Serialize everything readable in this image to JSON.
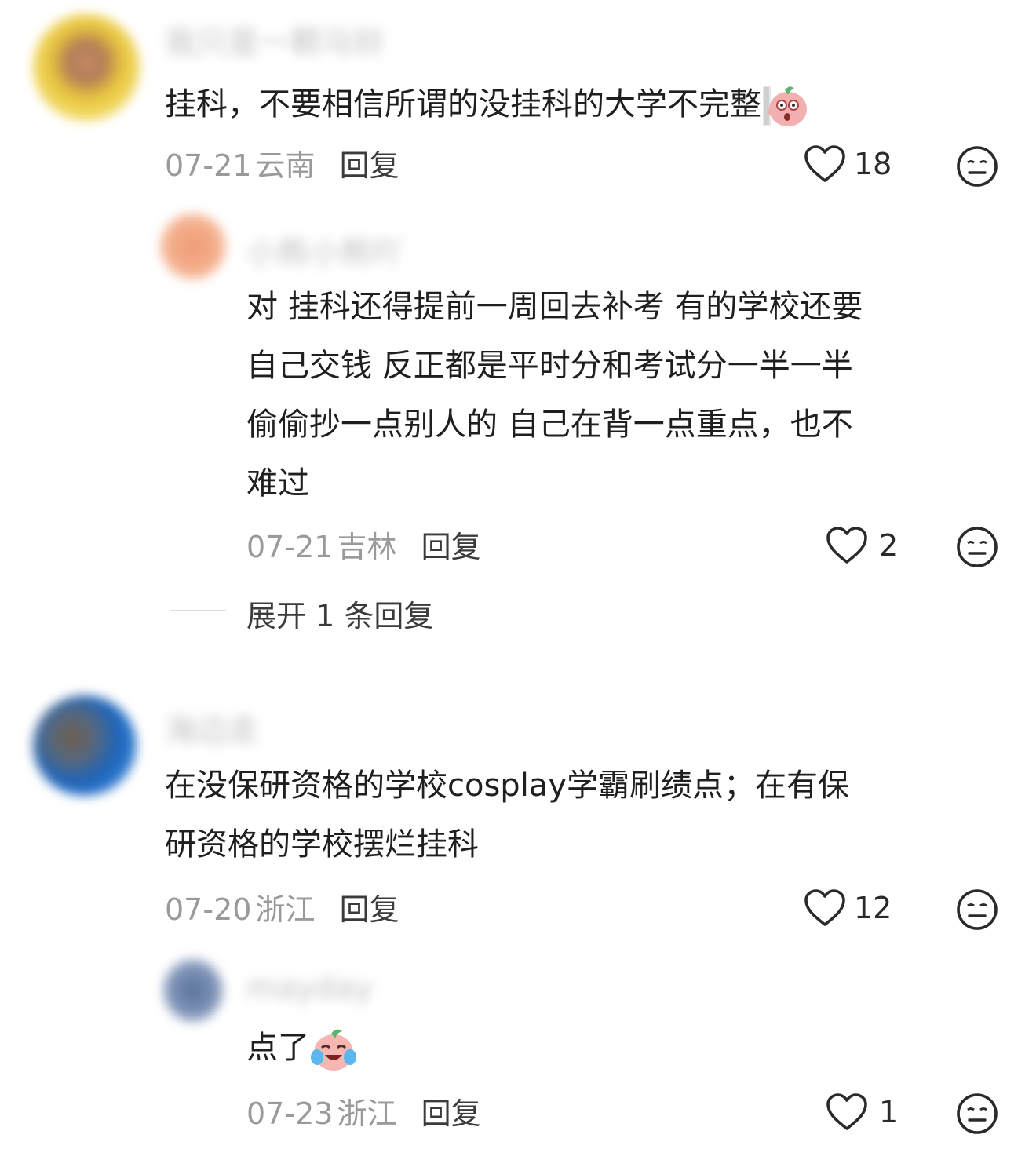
{
  "comments": [
    {
      "name": "我只是一颗马铃",
      "text": "挂科，不要相信所谓的没挂科的大学不完整",
      "emoji": "peach-peek-emoji",
      "date": "07-21",
      "location": "云南",
      "reply_label": "回复",
      "likes": "18",
      "replies": [
        {
          "name": "小熊小熊吖",
          "lines": [
            "对  挂科还得提前一周回去补考 有的学校还要",
            "自己交钱  反正都是平时分和考试分一半一半",
            "偷偷抄一点别人的  自己在背一点重点，也不",
            "难过"
          ],
          "date": "07-21",
          "location": "吉林",
          "reply_label": "回复",
          "likes": "2"
        }
      ],
      "expand_label": "展开 1 条回复"
    },
    {
      "name": "海边走",
      "lines": [
        "在没保研资格的学校cosplay学霸刷绩点；在有保",
        "研资格的学校摆烂挂科"
      ],
      "date": "07-20",
      "location": "浙江",
      "reply_label": "回复",
      "likes": "12",
      "replies": [
        {
          "name": "mayday",
          "text": "点了",
          "emoji": "peach-crying-laugh-emoji",
          "date": "07-23",
          "location": "浙江",
          "reply_label": "回复",
          "likes": "1"
        }
      ]
    }
  ],
  "colors": {
    "meta": "#9a9a9a",
    "text": "#1f1f1f",
    "peach": "#f3b0b0"
  },
  "icons": {
    "like": "heart-outline-icon",
    "dislike": "meh-face-icon"
  }
}
